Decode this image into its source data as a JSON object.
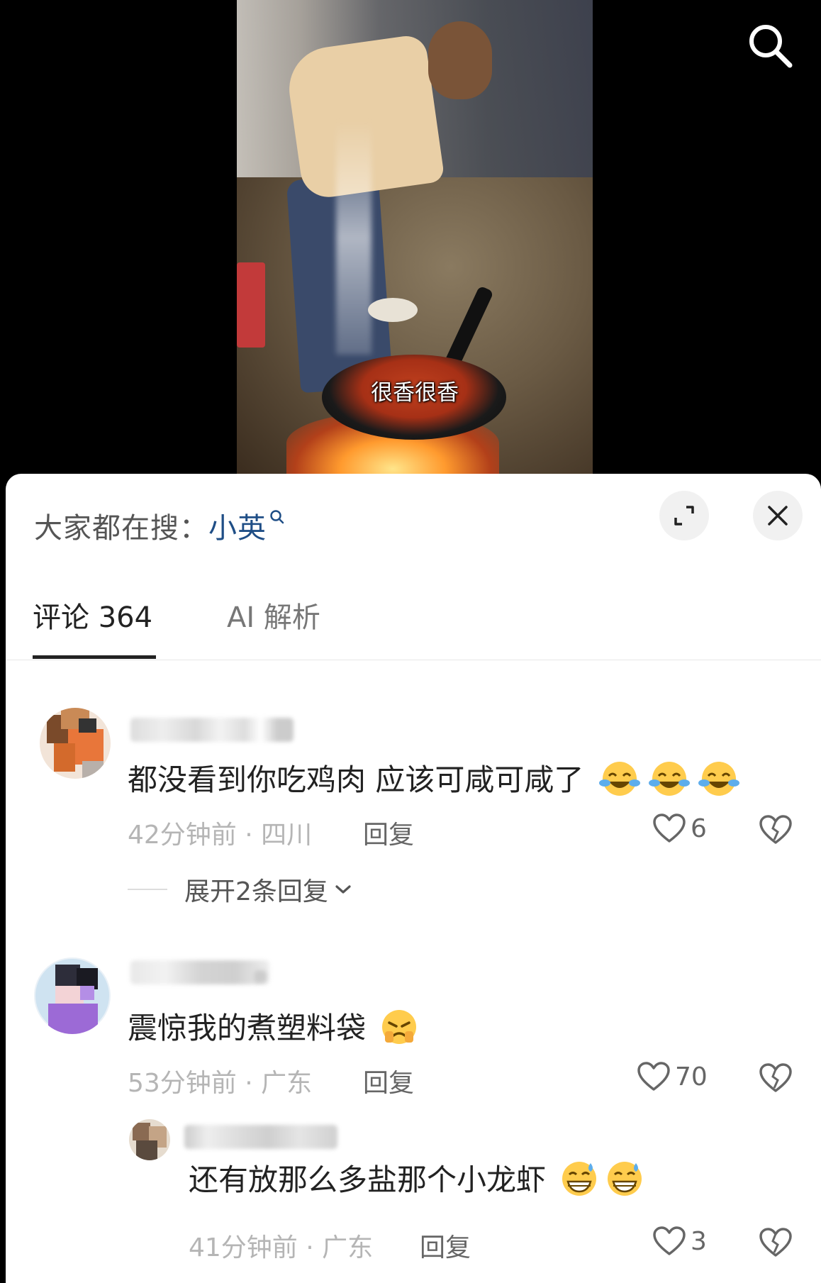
{
  "video": {
    "caption": "很香很香"
  },
  "panel": {
    "search_prefix": "大家都在搜：",
    "search_term": "小英",
    "tabs": [
      {
        "label": "评论 364"
      },
      {
        "label": "AI 解析"
      }
    ]
  },
  "comments": [
    {
      "text": "都没看到你吃鸡肉 应该可咸可咸了",
      "emoji": "laughing-tears",
      "emoji_count": 3,
      "time": "42分钟前",
      "location": "四川",
      "reply_label": "回复",
      "likes": "6",
      "expand_label": "展开2条回复"
    },
    {
      "text": "震惊我的煮塑料袋",
      "emoji": "pouting-face",
      "time": "53分钟前",
      "location": "广东",
      "reply_label": "回复",
      "likes": "70"
    }
  ],
  "replies": [
    {
      "text": "还有放那么多盐那个小龙虾",
      "emoji": "grinning-sweat",
      "emoji_count": 2,
      "time": "41分钟前",
      "location": "广东",
      "reply_label": "回复",
      "likes": "3"
    }
  ],
  "colors": {
    "search_term": "#1f4e86",
    "text_primary": "#222222",
    "meta": "#b5b5b5"
  }
}
